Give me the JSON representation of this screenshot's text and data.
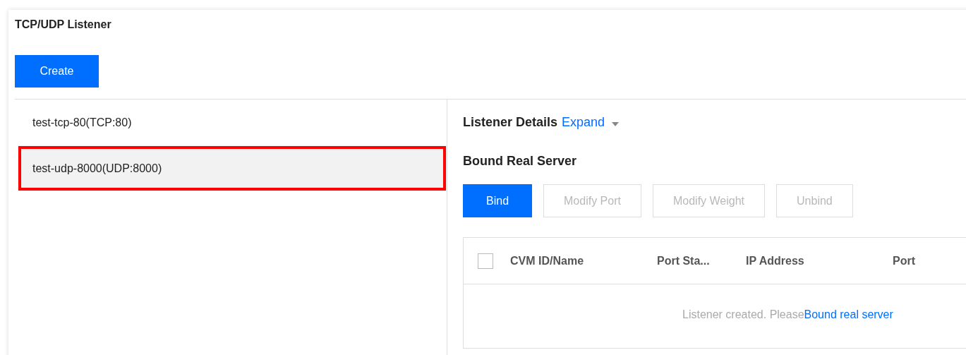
{
  "panel": {
    "title": "TCP/UDP Listener",
    "create_button": "Create"
  },
  "listeners": [
    {
      "label": "test-tcp-80(TCP:80)",
      "selected": false,
      "highlighted": false
    },
    {
      "label": "test-udp-8000(UDP:8000)",
      "selected": true,
      "highlighted": true
    }
  ],
  "details": {
    "title": "Listener Details",
    "expand_link": "Expand"
  },
  "real_server": {
    "title": "Bound Real Server",
    "buttons": [
      {
        "label": "Bind",
        "disabled": false
      },
      {
        "label": "Modify Port",
        "disabled": true
      },
      {
        "label": "Modify Weight",
        "disabled": true
      },
      {
        "label": "Unbind",
        "disabled": true
      }
    ],
    "table": {
      "select_all_checked": false,
      "columns": [
        "CVM ID/Name",
        "Port Sta...",
        "IP Address",
        "Port"
      ],
      "empty_message": "Listener created. Please",
      "empty_link": "Bound real server"
    }
  }
}
